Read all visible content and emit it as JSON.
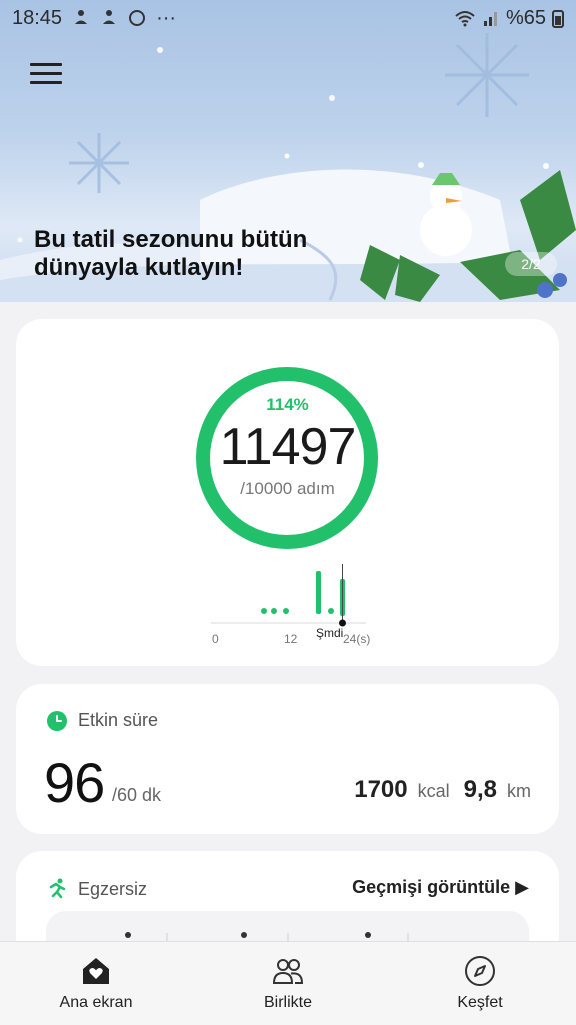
{
  "status_bar": {
    "time": "18:45",
    "dots": "···",
    "battery": "%65"
  },
  "banner": {
    "text": "Bu tatil sezonunu bütün dünyayla kutlayın!",
    "page": "2/2"
  },
  "steps_card": {
    "percent": "114%",
    "steps": "11497",
    "goal": "/10000 adım",
    "progress_fraction": 1.0,
    "chart_labels": {
      "start": "0",
      "mid": "12",
      "now": "Şmdi",
      "end": "24(s)"
    }
  },
  "active_card": {
    "title": "Etkin süre",
    "value": "96",
    "unit": "/60 dk",
    "kcal_value": "1700",
    "kcal_unit": "kcal",
    "km_value": "9,8",
    "km_unit": "km"
  },
  "exercise_card": {
    "title": "Egzersiz",
    "history_link": "Geçmişi görüntüle ▶"
  },
  "bottom_nav": [
    {
      "label": "Ana ekran"
    },
    {
      "label": "Birlikte"
    },
    {
      "label": "Keşfet"
    }
  ],
  "colors": {
    "accent": "#22c06a",
    "ring_track": "#e8f7ee"
  }
}
